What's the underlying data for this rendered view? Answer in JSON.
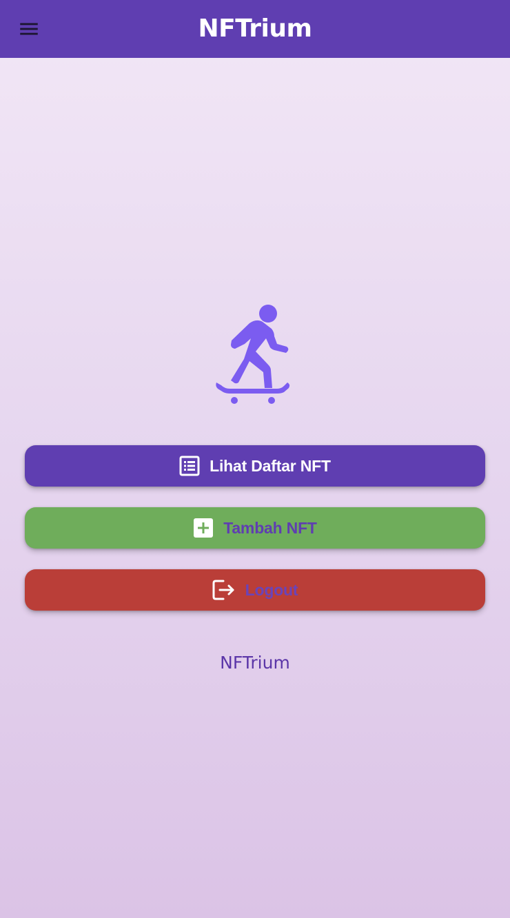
{
  "appbar": {
    "title": "NFTrium",
    "menu_icon": "menu-icon",
    "color": "#5f3eb1"
  },
  "hero": {
    "icon": "skateboarding-icon",
    "color": "#7b5cf0"
  },
  "buttons": {
    "list": {
      "label": "Lihat Daftar NFT",
      "icon": "list-icon",
      "color": "#5f3eb1"
    },
    "add": {
      "label": "Tambah NFT",
      "icon": "add-box-icon",
      "color": "#6fad5b"
    },
    "logout": {
      "label": "Logout",
      "icon": "logout-icon",
      "color": "#ba3e38"
    }
  },
  "footer": {
    "text": "NFTrium"
  }
}
